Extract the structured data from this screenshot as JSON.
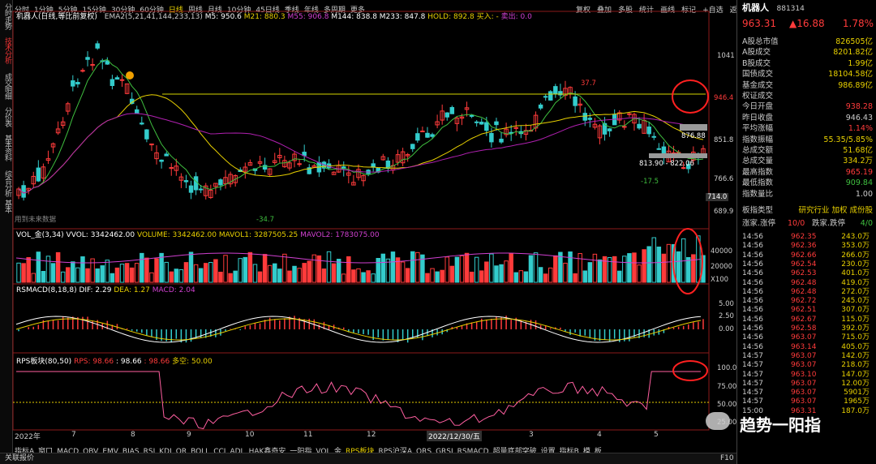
{
  "left_tabs": [
    "分时走势",
    "技术分析",
    "成交明细",
    "分价表",
    "基本资料",
    "综合分析",
    "基本"
  ],
  "top_tabs": [
    "分时",
    "1分钟",
    "5分钟",
    "15分钟",
    "30分钟",
    "60分钟",
    "日线",
    "周线",
    "月线",
    "10分钟",
    "45日线",
    "季线",
    "年线",
    "多周期",
    "更多"
  ],
  "toolbar": [
    "复权",
    "叠加",
    "多股",
    "统计",
    "画线",
    "标记",
    "+自选",
    "返回"
  ],
  "main_legend": {
    "name": "机器人(日线,等比前复权)",
    "ema": "EMA2(5,21,41,144,233,13)",
    "m5": "M5: 950.6",
    "m21": "M21: 880.3",
    "m55": "M55: 906.8",
    "m144": "M144: 838.8",
    "m233": "M233: 847.8",
    "hold": "HOLD: 892.8",
    "buy": "买入: -",
    "sell": "卖出: 0.0"
  },
  "main_axis": [
    "1041",
    "946.4",
    "851.8",
    "766.6",
    "689.9"
  ],
  "main_labels": {
    "high": "37.7",
    "low": "-34.7",
    "low2": "-17.5",
    "range": "813.90 - 822.06",
    "p876": "876.88",
    "p714": "714.0",
    "note": "用到未来数据"
  },
  "vol_legend": {
    "title": "VOL_金(3,34)",
    "vvol": "VVOL: 3342462.00",
    "volume": "VOLUME: 3342462.00",
    "mavol1": "MAVOL1: 3287505.25",
    "mavol2": "MAVOL2: 1783075.00"
  },
  "vol_axis": [
    "40000",
    "20000",
    "X100"
  ],
  "macd_legend": {
    "title": "RSMACD(8,18,8)",
    "dif": "DIF: 2.29",
    "dea": "DEA: 1.27",
    "macd": "MACD: 2.04"
  },
  "macd_axis": [
    "5.00",
    "2.50",
    "0.00"
  ],
  "rps_legend": {
    "title": "RPS板块(80,50)",
    "rps": "RPS: 98.66",
    "v2": ": 98.66",
    "v3": ": 98.66",
    "kong": "多空: 50.00"
  },
  "rps_axis": [
    "100.0",
    "75.00",
    "50.00",
    "25.00"
  ],
  "date_axis": {
    "y2022": "2022年",
    "m7": "7",
    "m8": "8",
    "m9": "9",
    "m10": "10",
    "m11": "11",
    "m12": "12",
    "d1230": "2022/12/30/五",
    "m2": "2",
    "m3": "3",
    "m4": "4",
    "m5": "5"
  },
  "bottom_tabs": [
    "指标A",
    "窗口",
    "MACD",
    "OBV",
    "EMV",
    "BIAS",
    "RSI",
    "KDJ",
    "QR",
    "BOLL",
    "CCI",
    "ADL",
    "HAK鑫奇安",
    "一阳指",
    "VOL_金",
    "RPS板块",
    "RPS沪深A",
    "QRS",
    "GRSI",
    "RSMACD",
    "超量底部突破",
    "设置",
    "指标B",
    "模",
    "板"
  ],
  "status": {
    "left": "关联报价",
    "right": "F10"
  },
  "panel": {
    "name": "机器人",
    "code": "881314",
    "price": "963.31",
    "chg": "▲16.88",
    "pct": "1.78%",
    "rows": [
      [
        "A股总市值",
        "826505亿"
      ],
      [
        "A股成交",
        "8201.82亿"
      ],
      [
        "B股成交",
        "1.99亿"
      ],
      [
        "国债成交",
        "18104.58亿"
      ],
      [
        "基金成交",
        "986.89亿"
      ],
      [
        "权证成交",
        ""
      ],
      [
        "今日开盘",
        "938.28"
      ],
      [
        "昨日收盘",
        "946.43"
      ],
      [
        "平均涨幅",
        "1.14%"
      ],
      [
        "指数振幅",
        "55.35/5.85%"
      ],
      [
        "总成交额",
        "51.68亿"
      ],
      [
        "总成交量",
        "334.2万"
      ],
      [
        "最高指数",
        "965.19"
      ],
      [
        "最低指数",
        "909.84"
      ],
      [
        "指数量比",
        "1.00"
      ]
    ],
    "hy": {
      "label": "板指类型",
      "val": "研究行业 加权 成份股"
    },
    "updown": {
      "l1": "涨家.涨停",
      "v1": "10/0",
      "l2": "跌家.跌停",
      "v2": "4/0"
    },
    "ticks": [
      [
        "14:56",
        "962.35",
        "243.0万"
      ],
      [
        "14:56",
        "962.36",
        "353.0万"
      ],
      [
        "14:56",
        "962.66",
        "266.0万"
      ],
      [
        "14:56",
        "962.54",
        "230.0万"
      ],
      [
        "14:56",
        "962.53",
        "401.0万"
      ],
      [
        "14:56",
        "962.48",
        "419.0万"
      ],
      [
        "14:56",
        "962.48",
        "272.0万"
      ],
      [
        "14:56",
        "962.72",
        "245.0万"
      ],
      [
        "14:56",
        "962.51",
        "307.0万"
      ],
      [
        "14:56",
        "962.67",
        "115.0万"
      ],
      [
        "14:56",
        "962.58",
        "392.0万"
      ],
      [
        "14:56",
        "963.07",
        "715.0万"
      ],
      [
        "14:56",
        "963.14",
        "405.0万"
      ],
      [
        "14:57",
        "963.07",
        "142.0万"
      ],
      [
        "14:57",
        "963.07",
        "218.0万"
      ],
      [
        "14:57",
        "963.10",
        "147.0万"
      ],
      [
        "14:57",
        "963.07",
        "12.00万"
      ],
      [
        "14:57",
        "963.07",
        "5901万"
      ],
      [
        "14:57",
        "963.07",
        "1965万"
      ],
      [
        "15:00",
        "963.31",
        "187.0万"
      ]
    ]
  },
  "watermark": "趋势一阳指",
  "colors": {
    "up": "#ff3b3b",
    "down": "#3cc",
    "yellow": "#e8d000",
    "magenta": "#d040d0",
    "green": "#3fbf3f"
  }
}
